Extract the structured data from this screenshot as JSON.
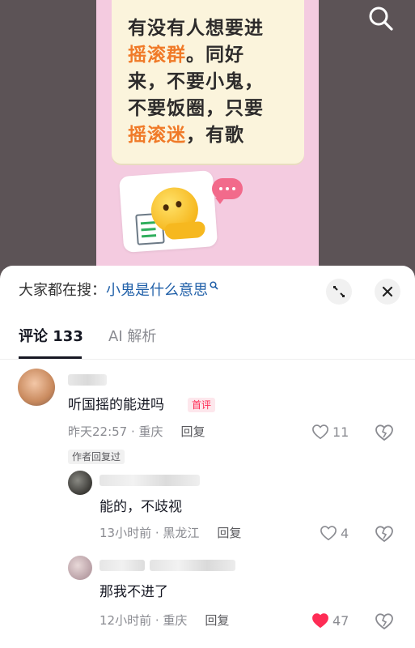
{
  "video": {
    "note_lines": [
      {
        "parts": [
          {
            "text": "有没有人想要进",
            "hl": false
          }
        ]
      },
      {
        "parts": [
          {
            "text": "摇滚群",
            "hl": true
          },
          {
            "text": "。同好",
            "hl": false
          }
        ]
      },
      {
        "parts": [
          {
            "text": "来，不要小鬼，",
            "hl": false
          }
        ]
      },
      {
        "parts": [
          {
            "text": "不要饭圈，只要",
            "hl": false
          }
        ]
      },
      {
        "parts": [
          {
            "text": "摇滚迷",
            "hl": true
          },
          {
            "text": "，有歌",
            "hl": false
          }
        ]
      }
    ],
    "highlight_color": "#f07a28",
    "poster_color": "#f4cbe0",
    "search_icon": "search-icon"
  },
  "sheet": {
    "search_prefix": "大家都在搜：",
    "search_keyword": "小鬼是什么意思",
    "expand_icon": "expand-icon",
    "close_icon": "close-icon",
    "tabs": [
      {
        "label": "评论 133",
        "active": true
      },
      {
        "label": "AI 解析",
        "active": false
      }
    ]
  },
  "comments": [
    {
      "text": "听国摇的能进吗",
      "badge": "首评",
      "time": "昨天22:57 · 重庆",
      "reply": "回复",
      "likes": "11",
      "liked": false,
      "author_tag": "作者回复过"
    }
  ],
  "replies": [
    {
      "text": "能的，不歧视",
      "time": "13小时前 · 黑龙江",
      "reply": "回复",
      "likes": "4",
      "liked": false
    },
    {
      "text": "那我不进了",
      "time": "12小时前 · 重庆",
      "reply": "回复",
      "likes": "47",
      "liked": true
    }
  ],
  "colors": {
    "accent_like": "#fe2c55",
    "link": "#1f5fa8"
  }
}
